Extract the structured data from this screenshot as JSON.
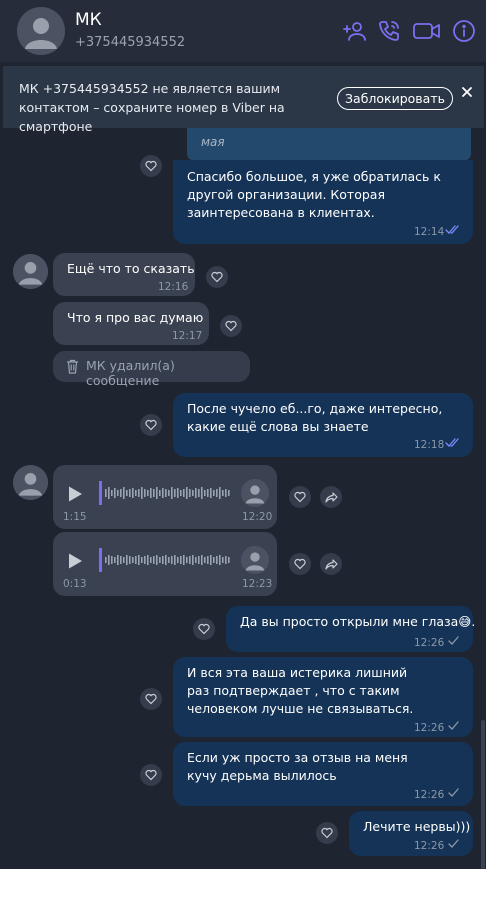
{
  "header": {
    "name": "МК",
    "phone": "+375445934552",
    "icons": [
      "add-contact-icon",
      "phone-icon",
      "video-icon",
      "info-icon"
    ]
  },
  "banner": {
    "text": "МК +375445934552 не является вашим контактом – сохраните номер в Viber на смартфоне",
    "block_label": "Заблокировать"
  },
  "colors": {
    "background": "#1e2430",
    "outgoing_bubble": "#143357",
    "incoming_bubble": "#3a4150",
    "accent": "#7b6ff0",
    "read_ticks": "#7b8cff"
  },
  "messages": {
    "quote_snippet": "мая",
    "m1": {
      "text": "Спасибо большое, я уже обратилась к другой организации. Которая заинтересована в клиентах.",
      "time": "12:14"
    },
    "m2": {
      "text": "Ещё что то сказать",
      "time": "12:16"
    },
    "m3": {
      "text": "Что я про вас думаю",
      "time": "12:17"
    },
    "deleted": {
      "text": "МК удалил(а) сообщение"
    },
    "m4": {
      "text": "После чучело еб...го, даже интересно, какие ещё слова вы знаете",
      "time": "12:18"
    },
    "voice1": {
      "duration": "1:15",
      "time": "12:20"
    },
    "voice2": {
      "duration": "0:13",
      "time": "12:23"
    },
    "m5": {
      "text": "Да вы просто открыли мне глаза😅.",
      "time": "12:26"
    },
    "m6": {
      "text": "И вся эта ваша истерика лишний раз подтверждает , что с таким человеком лучше не связываться.",
      "time": "12:26"
    },
    "m7": {
      "text": "Если уж просто за отзыв на меня кучу дерьма вылилось",
      "time": "12:26"
    },
    "m8": {
      "text": "Лечите нервы)))",
      "time": "12:26"
    }
  }
}
